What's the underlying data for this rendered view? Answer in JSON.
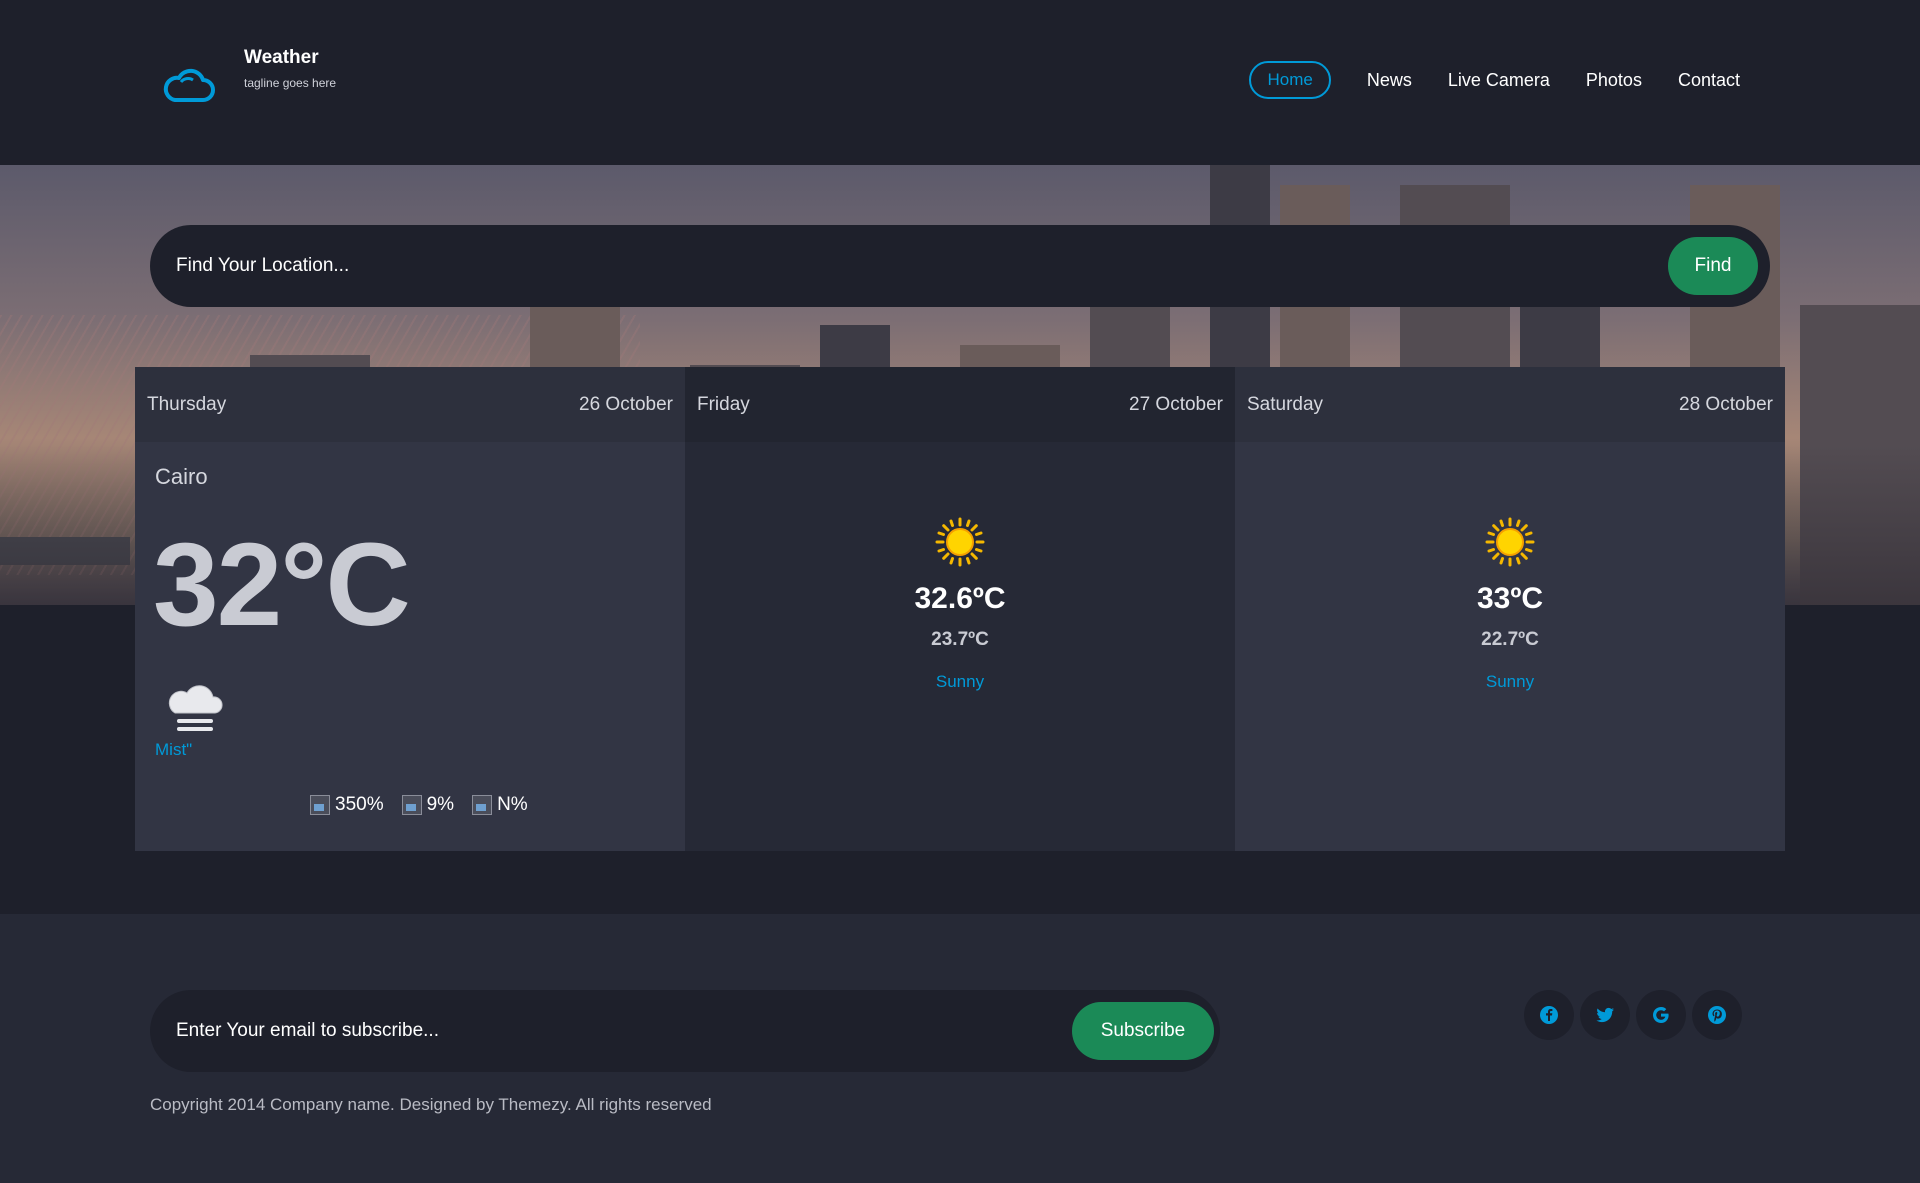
{
  "header": {
    "site_title": "Weather",
    "tagline": "tagline goes here",
    "nav": [
      "Home",
      "News",
      "Live Camera",
      "Photos",
      "Contact"
    ],
    "active_nav": "Home"
  },
  "search": {
    "placeholder": "Find Your Location...",
    "button_label": "Find"
  },
  "forecast": {
    "today": {
      "day": "Thursday",
      "date": "26 October",
      "location": "Cairo",
      "temperature": "32°C",
      "icon": "mist-icon",
      "condition": "Mist\"",
      "stats": [
        "350%",
        "9%",
        "N%"
      ]
    },
    "days": [
      {
        "day": "Friday",
        "date": "27 October",
        "icon": "sun-icon",
        "high": "32.6ºC",
        "low": "23.7ºC",
        "condition": "Sunny"
      },
      {
        "day": "Saturday",
        "date": "28 October",
        "icon": "sun-icon",
        "high": "33ºC",
        "low": "22.7ºC",
        "condition": "Sunny"
      }
    ]
  },
  "footer": {
    "subscribe_placeholder": "Enter Your email to subscribe...",
    "subscribe_button": "Subscribe",
    "copyright": "Copyright 2014 Company name. Designed by Themezy. All rights reserved",
    "social": [
      "facebook-icon",
      "twitter-icon",
      "google-icon",
      "pinterest-icon"
    ]
  },
  "colors": {
    "background": "#1e202b",
    "accent": "#009ad8",
    "button": "#1b8a57",
    "card": "#323544",
    "card_alt": "#262936"
  }
}
